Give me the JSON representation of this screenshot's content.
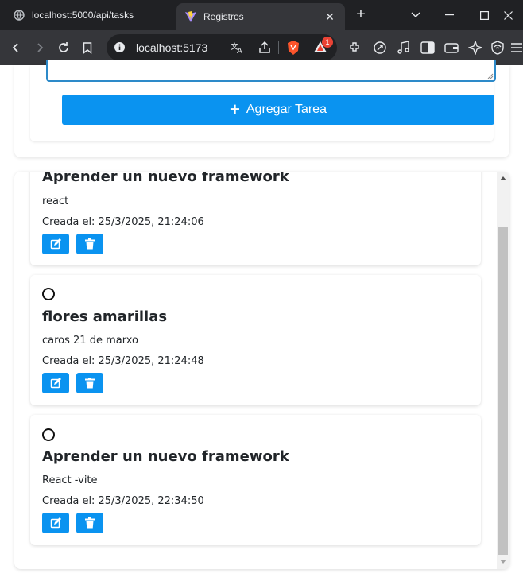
{
  "browser": {
    "tabs": [
      {
        "label": "localhost:5000/api/tasks",
        "icon": "globe-icon",
        "active": false
      },
      {
        "label": "Registros",
        "icon": "vite-logo-icon",
        "active": true
      }
    ],
    "url": "localhost:5173",
    "notification_count": "1"
  },
  "form": {
    "add_button_label": "Agregar Tarea",
    "add_button_icon": "plus-icon"
  },
  "tasks": [
    {
      "title": "Aprender un nuevo framework",
      "description": "react",
      "created_label": "Creada el:",
      "created_at": "25/3/2025, 21:24:06"
    },
    {
      "title": "flores amarillas",
      "description": "caros 21 de marxo",
      "created_label": "Creada el:",
      "created_at": "25/3/2025, 21:24:48"
    },
    {
      "title": "Aprender un nuevo framework",
      "description": "React -vite",
      "created_label": "Creada el:",
      "created_at": "25/3/2025, 22:34:50"
    }
  ],
  "colors": {
    "primary": "#0a93f0",
    "focus_border": "#2d8ac9",
    "browser_dark": "#202124",
    "browser_toolbar": "#35363a"
  }
}
